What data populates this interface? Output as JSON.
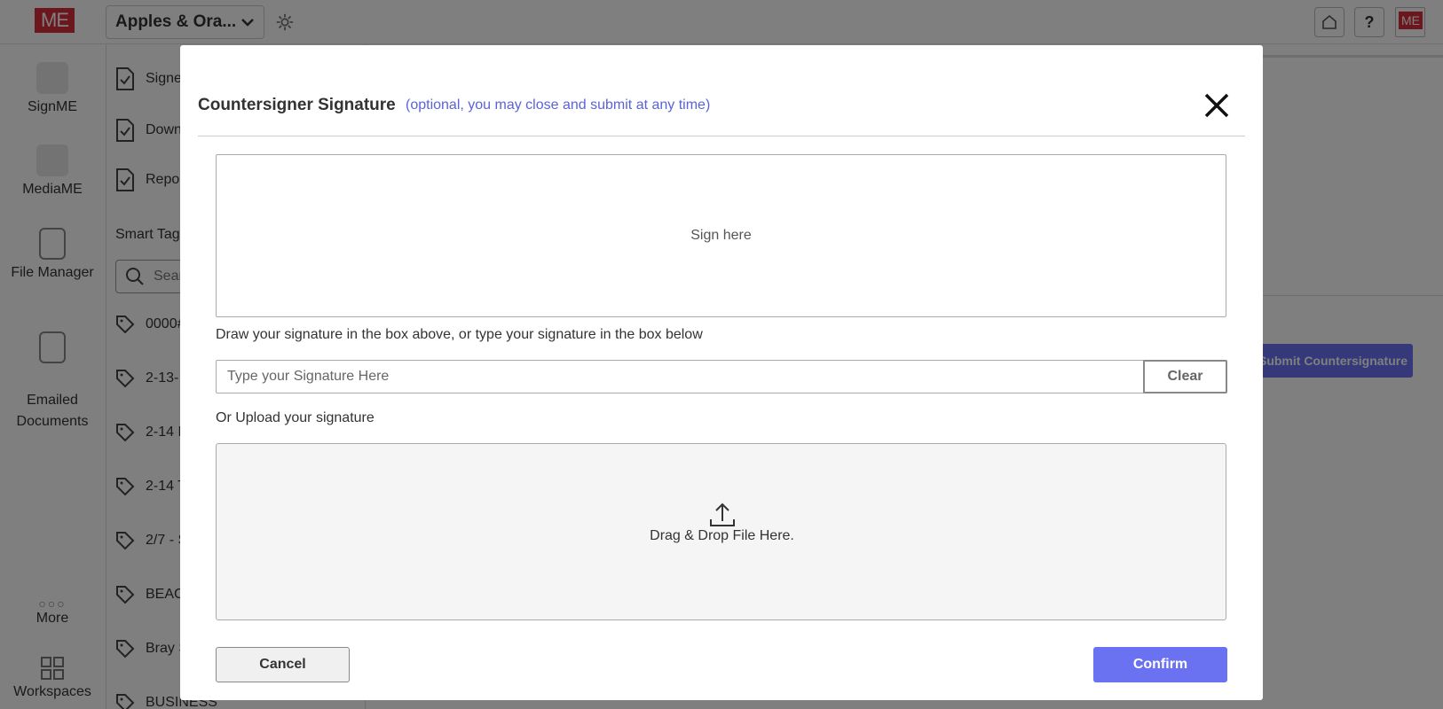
{
  "app": {
    "logo_text": "ME",
    "workspace_name": "Apples & Ora...",
    "header_logo_text": "ME"
  },
  "leftnav": {
    "items": [
      {
        "label": "SignME",
        "icon": "pen-icon"
      },
      {
        "label": "MediaME",
        "icon": "media-icon"
      },
      {
        "label": "File Manager",
        "icon": "file-icon"
      },
      {
        "label": "Emailed\nDocuments",
        "icon": "email-doc-icon"
      },
      {
        "label": "More",
        "icon": "more-dots-icon"
      },
      {
        "label": "Workspaces",
        "icon": "grid-icon"
      }
    ]
  },
  "sidepanel": {
    "doc_items": [
      "Signe",
      "Down",
      "Repor"
    ],
    "smart_tags_label": "Smart Tags",
    "search_placeholder": "Sear",
    "tags": [
      "0000#",
      "2-13-",
      "2-14 N",
      "2-14 T",
      "2/7 - S",
      "BEAC",
      "Bray S",
      "BUSINESS"
    ]
  },
  "main": {
    "help_label": "?",
    "submit_countersignature_label": "Submit Countersignature"
  },
  "modal": {
    "title": "Countersigner Signature",
    "subtitle": "(optional, you may close and submit at any time)",
    "sign_pad_label": "Sign here",
    "draw_hint": "Draw your signature in the box above, or type your signature in the box below",
    "type_placeholder": "Type your Signature Here",
    "clear_label": "Clear",
    "upload_label": "Or Upload your signature",
    "dropzone_text": "Drag & Drop File Here.",
    "cancel_label": "Cancel",
    "confirm_label": "Confirm"
  },
  "colors": {
    "accent": "#6a72f2",
    "brand_red": "#d62e3a",
    "subtitle": "#5a63d8"
  }
}
